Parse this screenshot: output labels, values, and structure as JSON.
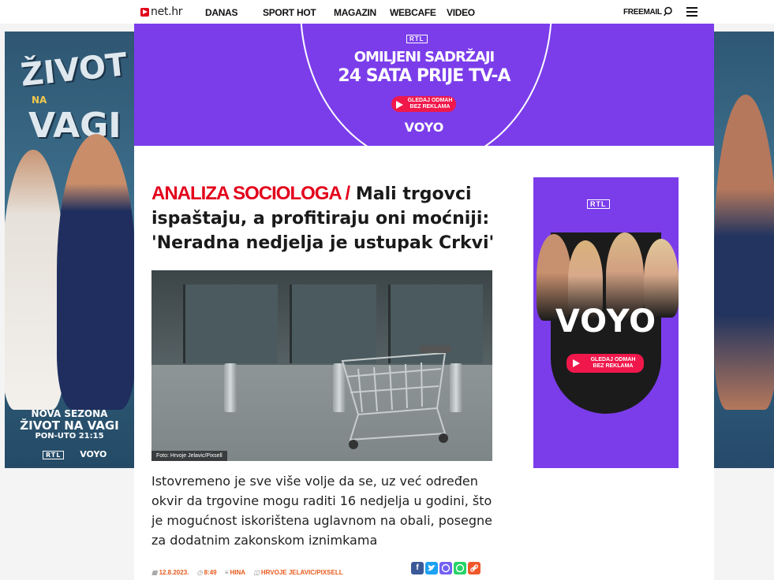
{
  "header": {
    "logo_text": "net.hr",
    "nav": [
      "DANAS",
      "SPORT",
      "HOT",
      "MAGAZIN",
      "WEBCAFE",
      "VIDEO"
    ],
    "freemail": "FREEMAIL",
    "icons": [
      "search-icon",
      "menu-icon"
    ]
  },
  "left_ad": {
    "title_line1": "ŽIVOT",
    "title_line2": "NA",
    "title_line3": "VAGI",
    "caption_line1": "NOVA SEZONA",
    "caption_line2": "ŽIVOT NA VAGI",
    "caption_line3": "PON-UTO 21:15",
    "logo1": "RTL",
    "logo2": "VOYO"
  },
  "top_banner": {
    "brand": "RTL",
    "line1": "OMILJENI SADRŽAJI",
    "line2": "24 SATA PRIJE TV-A",
    "cta_line1": "GLEDAJ ODMAH",
    "cta_line2": "BEZ REKLAMA",
    "logo": "VOYO",
    "color": "#7b3dea"
  },
  "article": {
    "kicker": "ANALIZA SOCIOLOGA /",
    "title": "Mali trgovci ispaštaju, a profitiraju oni moćniji: 'Neradna nedjelja je ustupak Crkvi'",
    "photo_credit": "Foto: Hrvoje Jelavic/Pixsell",
    "lead": "Istovremeno je sve više volje da se, uz već određen okvir da trgovine mogu raditi 16 nedjelja u godini, što je mogućnost iskorištena uglavnom na obali, posegne za dodatnim zakonskom iznimkama",
    "meta": {
      "date": "12.8.2023.",
      "time": "8:49",
      "source": "HINA",
      "photo": "HRVOJE JELAVIC/PIXSELL"
    },
    "share": [
      {
        "icon": "facebook-icon",
        "glyph": "f",
        "color": "#3b5998"
      },
      {
        "icon": "twitter-icon",
        "glyph": "t",
        "color": "#1da1f2"
      },
      {
        "icon": "viber-icon",
        "glyph": "v",
        "color": "#7360f2"
      },
      {
        "icon": "whatsapp-icon",
        "glyph": "w",
        "color": "#25d366"
      },
      {
        "icon": "link-icon",
        "glyph": "∞",
        "color": "#f0572b"
      }
    ],
    "accent_color": "#e3001b"
  },
  "right_ad": {
    "brand": "RTL",
    "logo": "VOYO",
    "cta_line1": "GLEDAJ ODMAH",
    "cta_line2": "BEZ REKLAMA"
  }
}
